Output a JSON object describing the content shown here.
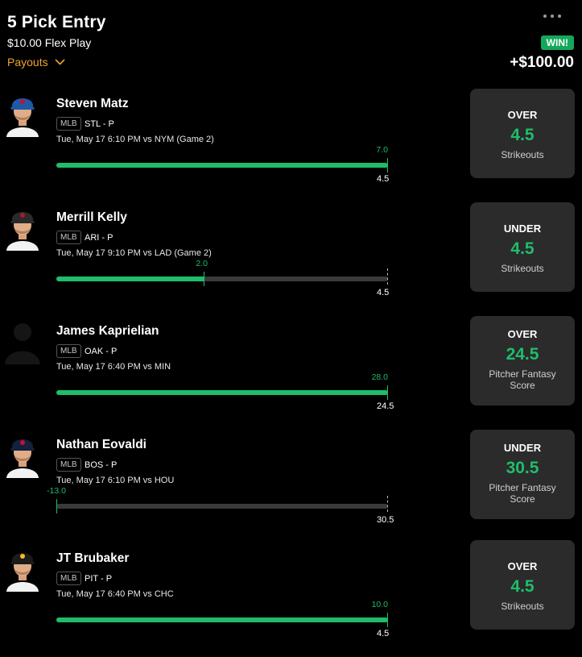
{
  "header": {
    "title": "5 Pick Entry",
    "subtitle": "$10.00 Flex Play",
    "payouts_label": "Payouts",
    "status_badge": "WIN!",
    "total": "+$100.00"
  },
  "colors": {
    "accent_green": "#1fbd6a",
    "payouts_orange": "#f0a32f",
    "card_bg": "#2b2b2b"
  },
  "picks": [
    {
      "name": "Steven Matz",
      "league": "MLB",
      "team_pos": "STL - P",
      "game": "Tue, May 17 6:10 PM  vs NYM (Game 2)",
      "actual": "7.0",
      "line": "4.5",
      "progress": 1.0,
      "direction": "OVER",
      "stat": "Strikeouts",
      "avatar": "blue-jays-player-icon"
    },
    {
      "name": "Merrill Kelly",
      "league": "MLB",
      "team_pos": "ARI - P",
      "game": "Tue, May 17 9:10 PM  vs LAD (Game 2)",
      "actual": "2.0",
      "line": "4.5",
      "progress": 0.444,
      "direction": "UNDER",
      "stat": "Strikeouts",
      "avatar": "diamondbacks-player-icon"
    },
    {
      "name": "James Kaprielian",
      "league": "MLB",
      "team_pos": "OAK - P",
      "game": "Tue, May 17 6:40 PM  vs MIN",
      "actual": "28.0",
      "line": "24.5",
      "progress": 1.0,
      "direction": "OVER",
      "stat": "Pitcher Fantasy Score",
      "avatar": "silhouette-icon"
    },
    {
      "name": "Nathan Eovaldi",
      "league": "MLB",
      "team_pos": "BOS - P",
      "game": "Tue, May 17 6:10 PM  vs HOU",
      "actual": "-13.0",
      "line": "30.5",
      "progress": 0.0,
      "direction": "UNDER",
      "stat": "Pitcher Fantasy Score",
      "avatar": "red-sox-player-icon"
    },
    {
      "name": "JT Brubaker",
      "league": "MLB",
      "team_pos": "PIT - P",
      "game": "Tue, May 17 6:40 PM  vs CHC",
      "actual": "10.0",
      "line": "4.5",
      "progress": 1.0,
      "direction": "OVER",
      "stat": "Strikeouts",
      "avatar": "pirates-player-icon"
    }
  ]
}
